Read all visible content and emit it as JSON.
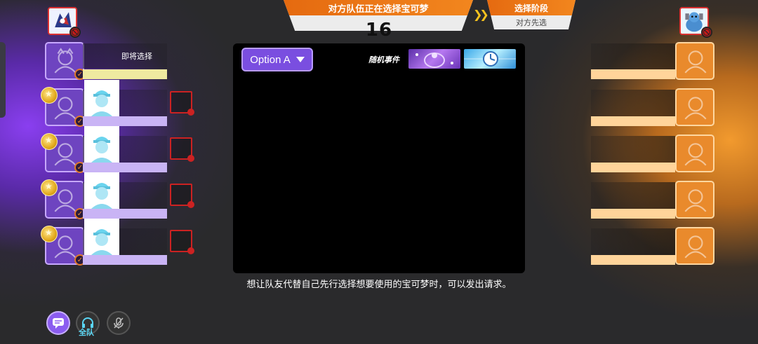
{
  "header": {
    "status": "对方队伍正在选择宝可梦",
    "timer": "16",
    "phase_title": "选择阶段",
    "phase_sub": "对方先选"
  },
  "left_team": {
    "ready_label": "即将选择"
  },
  "panel": {
    "option_label": "Option A",
    "event_label": "随机事件"
  },
  "hint": "想让队友代替自己先行选择想要使用的宝可梦时，可以发出请求。",
  "voice": {
    "team_label": "全队"
  },
  "colors": {
    "left_team": "#8a3ff0",
    "right_team": "#f29a2e",
    "header_orange": "#e56a10",
    "ban_red": "#c21a1a"
  }
}
